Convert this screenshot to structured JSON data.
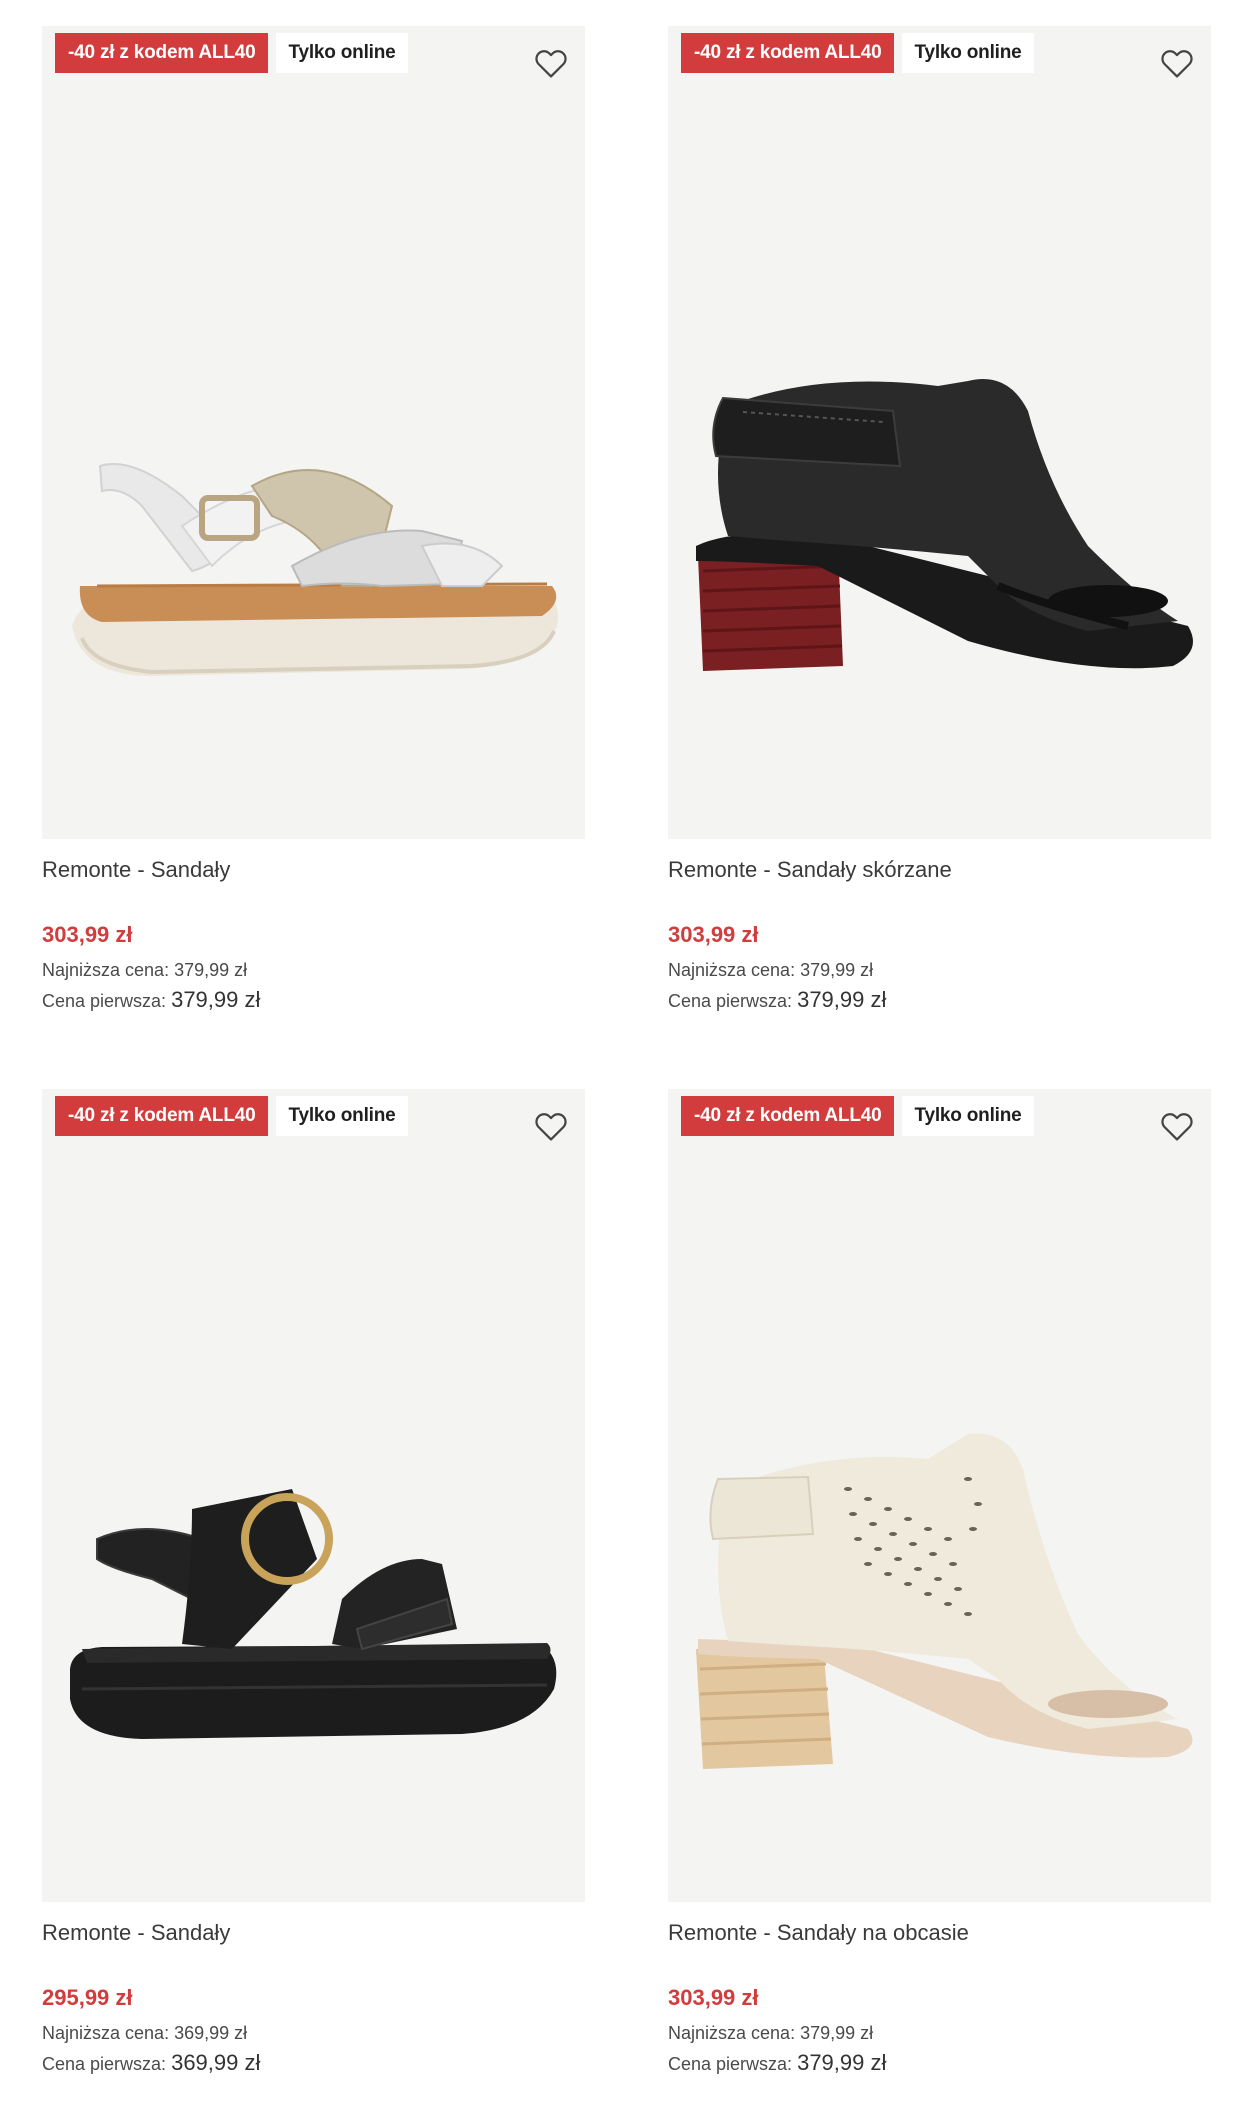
{
  "products": [
    {
      "promo_badge": "-40 zł z kodem ALL40",
      "online_badge": "Tylko online",
      "name": "Remonte - Sandały",
      "price": "303,99 zł",
      "lowest_label": "Najniższa cena:",
      "lowest_value": "379,99 zł",
      "original_label": "Cena pierwsza:",
      "original_value": "379,99 zł",
      "image_icon": "white-gold-wedge-sandal"
    },
    {
      "promo_badge": "-40 zł z kodem ALL40",
      "online_badge": "Tylko online",
      "name": "Remonte - Sandały skórzane",
      "price": "303,99 zł",
      "lowest_label": "Najniższa cena:",
      "lowest_value": "379,99 zł",
      "original_label": "Cena pierwsza:",
      "original_value": "379,99 zł",
      "image_icon": "black-heeled-bootie-sandal"
    },
    {
      "promo_badge": "-40 zł z kodem ALL40",
      "online_badge": "Tylko online",
      "name": "Remonte - Sandały",
      "price": "295,99 zł",
      "lowest_label": "Najniższa cena:",
      "lowest_value": "369,99 zł",
      "original_label": "Cena pierwsza:",
      "original_value": "369,99 zł",
      "image_icon": "black-buckle-platform-sandal"
    },
    {
      "promo_badge": "-40 zł z kodem ALL40",
      "online_badge": "Tylko online",
      "name": "Remonte - Sandały na obcasie",
      "price": "303,99 zł",
      "lowest_label": "Najniższa cena:",
      "lowest_value": "379,99 zł",
      "original_label": "Cena pierwsza:",
      "original_value": "379,99 zł",
      "image_icon": "cream-perforated-heeled-sandal"
    }
  ],
  "colors": {
    "promo": "#d33c3c",
    "image_bg": "#f4f4f3",
    "price": "#d33c3c"
  },
  "icons": {
    "wishlist": "heart-outline-icon"
  }
}
